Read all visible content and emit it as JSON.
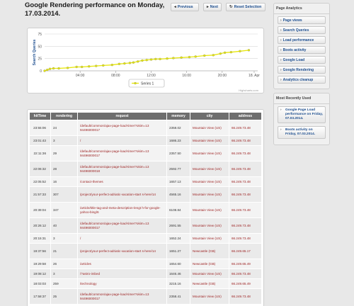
{
  "header": {
    "title": "Google Rendering performance on Monday, 17.03.2014.",
    "prev_label": "Previous",
    "next_label": "Next",
    "reset_label": "Reset Selection"
  },
  "chart_data": {
    "type": "line",
    "xlabel": "",
    "ylabel": "Search Queries",
    "y_ticks": [
      "75",
      "50",
      "25",
      "0"
    ],
    "x_ticks": [
      "04:00",
      "08:00",
      "12:00",
      "16:00",
      "20:00",
      "18. Apr"
    ],
    "ylim": [
      0,
      75
    ],
    "legend": "Series 1",
    "credit": "Highcharts.com",
    "line_color": "#e8e80a",
    "x": [
      0.0,
      0.3,
      0.6,
      1.0,
      1.6,
      2.6,
      3.6,
      4.2,
      5.0,
      5.8,
      6.6,
      7.6,
      8.4,
      9.0,
      9.6,
      10.0,
      10.5,
      11.0,
      11.5,
      12.0,
      12.5,
      13.0,
      13.8,
      14.5,
      15.4,
      16.3,
      17.0,
      18.0,
      19.0,
      19.8,
      20.3,
      21.0,
      22.0,
      23.0
    ],
    "y": [
      0,
      2,
      4,
      5,
      5,
      6,
      8,
      8,
      9,
      10,
      11,
      12,
      14,
      15,
      16,
      17,
      19,
      21,
      22,
      23,
      24,
      24,
      25,
      26,
      27,
      28,
      29,
      31,
      32,
      35,
      37,
      38,
      40,
      42
    ],
    "grid": true
  },
  "table": {
    "headers": [
      "hitTime",
      "rendering",
      "request",
      "memory",
      "city",
      "address"
    ],
    "rows": [
      [
        "23:55:06",
        "24",
        "/default/common/ajax-page-load-timer?okim=13 94496000017",
        "2358.02",
        "Mountain View (US)",
        "66.249.73.48"
      ],
      [
        "23:01:43",
        "3",
        "/",
        "1686.23",
        "Mountain View (US)",
        "66.249.73.48"
      ],
      [
        "22:11:36",
        "29",
        "/default/common/ajax-page-load-timer?okim=13 94496000017",
        "2357.50",
        "Mountain View (US)",
        "66.249.73.48"
      ],
      [
        "22:06:32",
        "28",
        "/default/common/ajax-page-load-timer?okim=13 94496000018",
        "2592.77",
        "Mountain View (US)",
        "66.249.73.48"
      ],
      [
        "22:05:52",
        "16",
        "/contact-themes",
        "1657.13",
        "Mountain View (US)",
        "66.249.73.48"
      ],
      [
        "21:57:33",
        "307",
        "/project/your-perfect-adriatic-vacation-start s-here/14",
        "4565.16",
        "Mountain View (US)",
        "66.249.73.48"
      ],
      [
        "20:39:04",
        "347",
        "/article/title-tag-and-meta-description-lengt h-for-google-yahoo-bing/6",
        "6108.84",
        "Mountain View (US)",
        "66.249.73.48"
      ],
      [
        "20:26:12",
        "40",
        "/default/common/ajax-page-load-timer?okim=13 94496000017",
        "2691.55",
        "Mountain View (US)",
        "66.249.73.48"
      ],
      [
        "20:15:31",
        "3",
        "/",
        "1652.24",
        "Mountain View (US)",
        "66.249.73.48"
      ],
      [
        "19:37:56",
        "21",
        "/project/your-perfect-adriatic-vacation-start s-here/14",
        "1651.27",
        "Newcastle (GB)",
        "66.249.65.17"
      ],
      [
        "19:29:58",
        "26",
        "/articles",
        "1654.60",
        "Newcastle (GB)",
        "66.249.65.49"
      ],
      [
        "19:08:12",
        "3",
        "/?astro-imbed",
        "1646.46",
        "Mountain View (US)",
        "66.249.73.48"
      ],
      [
        "18:03:03",
        "259",
        "/technology",
        "3215.16",
        "Newcastle (GB)",
        "66.249.65.49"
      ],
      [
        "17:58:37",
        "25",
        "/default/common/ajax-page-load-timer?okim=13 94496000017",
        "2358.41",
        "Mountain View (US)",
        "66.249.73.48"
      ]
    ]
  },
  "sidebar": {
    "analytics_title": "Page Analytics",
    "items": [
      {
        "label": "Page views"
      },
      {
        "label": "Search Queries"
      },
      {
        "label": "Load performance"
      },
      {
        "label": "Boots activity"
      },
      {
        "label": "Google Load"
      },
      {
        "label": "Google Rendering"
      },
      {
        "label": "Analytics cleanup"
      }
    ],
    "recent_title": "Most Recently Used",
    "recent": [
      {
        "label": "Google Page Load performance on Friday, 07.03.2014."
      },
      {
        "label": "Boots activity on Friday, 07.03.2014."
      }
    ]
  }
}
